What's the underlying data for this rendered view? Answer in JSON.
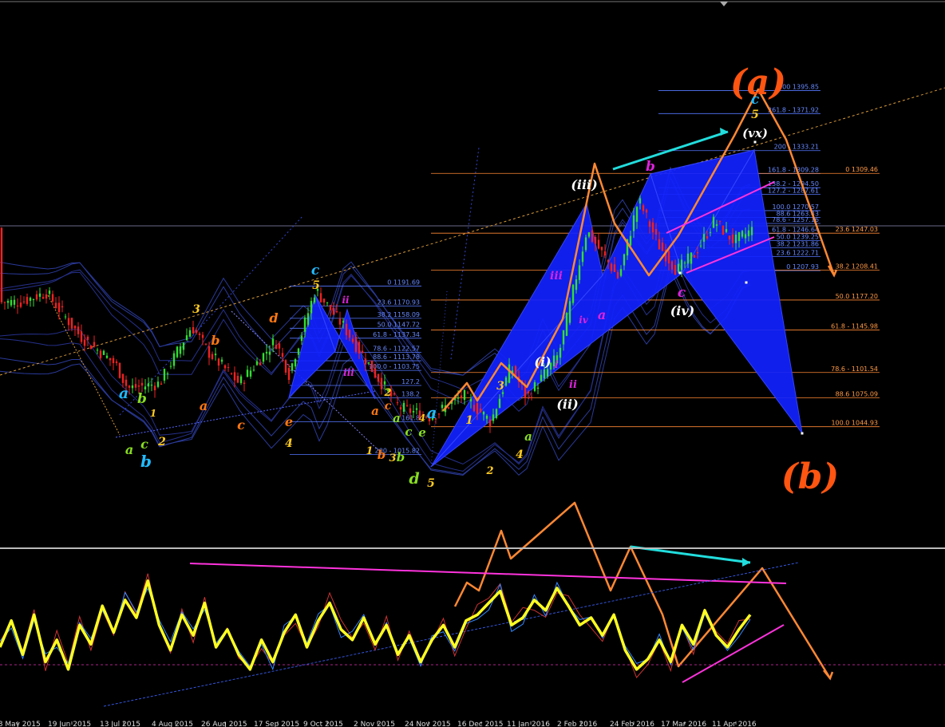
{
  "colors": {
    "background": "#000000",
    "candle_up": "#33dd33",
    "candle_down": "#ee2222",
    "fib_blue": "#5577ff",
    "fib_orange": "#ff8833",
    "pattern_fill": "#1122ff",
    "impulse_orange": "#ff8833",
    "cyan": "#22dddd",
    "magenta": "#ff33dd",
    "oscillator_main": "#ffff22",
    "oscillator_signal": "#3388ff"
  },
  "chart_data": [
    {
      "type": "candlestick",
      "panel": "price",
      "title": "",
      "xlabel": "",
      "ylabel": "",
      "ylim": [
        1000,
        1410
      ],
      "x_ticks": [
        "28 May 2015",
        "19 Jun 2015",
        "13 Jul 2015",
        "4 Aug 2015",
        "26 Aug 2015",
        "17 Sep 2015",
        "9 Oct 2015",
        "2 Nov 2015",
        "24 Nov 2015",
        "16 Dec 2015",
        "11 Jan 2016",
        "2 Feb 2016",
        "24 Feb 2016",
        "17 Mar 2016",
        "11 Apr 2016"
      ],
      "fib_levels_blue": [
        {
          "label": "0 1191.69",
          "price": 1191.69
        },
        {
          "label": "23.6 1170.93",
          "price": 1170.93
        },
        {
          "label": "38.2 1158.09",
          "price": 1158.09
        },
        {
          "label": "50.0 1147.72",
          "price": 1147.72
        },
        {
          "label": "61.8 - 1137.34",
          "price": 1137.34
        },
        {
          "label": "78.6 - 1122.57",
          "price": 1122.57
        },
        {
          "label": "88.6 - 1113.78",
          "price": 1113.78
        },
        {
          "label": "100.0 - 1103.75",
          "price": 1103.75
        },
        {
          "label": "127.2",
          "price": 1088
        },
        {
          "label": "138.2",
          "price": 1075
        },
        {
          "label": "161.8",
          "price": 1050
        },
        {
          "label": "200 - 1015.82",
          "price": 1015.82
        },
        {
          "label": "300 1395.85",
          "price": 1395.85
        },
        {
          "label": "261.8 - 1371.92",
          "price": 1371.92
        },
        {
          "label": "200 - 1333.21",
          "price": 1333.21
        },
        {
          "label": "161.8 - 1309.28",
          "price": 1309.28
        },
        {
          "label": "138.2 - 1294.50",
          "price": 1294.5
        },
        {
          "label": "127.2 - 1287.61",
          "price": 1287.61
        },
        {
          "label": "100.0 1270.57",
          "price": 1270.57
        },
        {
          "label": "88.6 1263.43",
          "price": 1263.43
        },
        {
          "label": "78.6 - 1257.16",
          "price": 1257.16
        },
        {
          "label": "61.8 - 1246.64",
          "price": 1246.64
        },
        {
          "label": "50.0 1239.25",
          "price": 1239.25
        },
        {
          "label": "38.2 1231.86",
          "price": 1231.86
        },
        {
          "label": "23.6 1222.71",
          "price": 1222.71
        },
        {
          "label": "0 1207.93",
          "price": 1207.93
        }
      ],
      "fib_levels_orange": [
        {
          "label": "0 1309.46",
          "price": 1309.46
        },
        {
          "label": "23.6 1247.03",
          "price": 1247.03
        },
        {
          "label": "38.2 1208.41",
          "price": 1208.41
        },
        {
          "label": "50.0 1177.20",
          "price": 1177.2
        },
        {
          "label": "61.8 - 1145.98",
          "price": 1145.98
        },
        {
          "label": "78.6 - 1101.54",
          "price": 1101.54
        },
        {
          "label": "88.6 1075.09",
          "price": 1075.09
        },
        {
          "label": "100.0 1044.93",
          "price": 1044.93
        }
      ],
      "wave_labels": [
        {
          "text": "(a)",
          "color": "#ff5511"
        },
        {
          "text": "(b)",
          "color": "#ff5511"
        },
        {
          "text": "c",
          "color": "#22bbff"
        },
        {
          "text": "5",
          "color": "#ffcc22"
        },
        {
          "text": "3",
          "color": "#ffcc22"
        },
        {
          "text": "d",
          "color": "#ff7711"
        },
        {
          "text": "b",
          "color": "#ff7711"
        },
        {
          "text": "a",
          "color": "#ff7711"
        },
        {
          "text": "c",
          "color": "#ff7711"
        },
        {
          "text": "e",
          "color": "#ff7711"
        },
        {
          "text": "4",
          "color": "#ffcc22"
        },
        {
          "text": "a",
          "color": "#22bbff"
        },
        {
          "text": "b",
          "color": "#88dd22"
        },
        {
          "text": "1",
          "color": "#ffcc22"
        },
        {
          "text": "a",
          "color": "#88dd22"
        },
        {
          "text": "c",
          "color": "#88dd22"
        },
        {
          "text": "2",
          "color": "#ffcc22"
        },
        {
          "text": "b",
          "color": "#22bbff"
        },
        {
          "text": "ii",
          "color": "#dd22dd"
        },
        {
          "text": "iii",
          "color": "#dd22dd"
        },
        {
          "text": "2",
          "color": "#ffcc22"
        },
        {
          "text": "a",
          "color": "#ff7711"
        },
        {
          "text": "c",
          "color": "#ff7711"
        },
        {
          "text": "1",
          "color": "#ffcc22"
        },
        {
          "text": "b",
          "color": "#ff7711"
        },
        {
          "text": "3",
          "color": "#ffcc22"
        },
        {
          "text": "b",
          "color": "#88dd22"
        },
        {
          "text": "a",
          "color": "#88dd22"
        },
        {
          "text": "c",
          "color": "#88dd22"
        },
        {
          "text": "e",
          "color": "#88dd22"
        },
        {
          "text": "d",
          "color": "#88dd22"
        },
        {
          "text": "5",
          "color": "#ffcc22"
        },
        {
          "text": "a",
          "color": "#22bbff"
        },
        {
          "text": "4",
          "color": "#ffcc22"
        },
        {
          "text": "1",
          "color": "#ffcc22"
        },
        {
          "text": "3",
          "color": "#ffcc22"
        },
        {
          "text": "2",
          "color": "#ffcc22"
        },
        {
          "text": "a",
          "color": "#88dd22"
        },
        {
          "text": "4",
          "color": "#ffcc22"
        },
        {
          "text": "(i)",
          "color": "#ffffff"
        },
        {
          "text": "i",
          "color": "#dd22dd"
        },
        {
          "text": "ii",
          "color": "#dd22dd"
        },
        {
          "text": "(ii)",
          "color": "#ffffff"
        },
        {
          "text": "iii",
          "color": "#dd22dd"
        },
        {
          "text": "iv",
          "color": "#dd22dd"
        },
        {
          "text": "a",
          "color": "#dd22dd"
        },
        {
          "text": "(iii)",
          "color": "#ffffff"
        },
        {
          "text": "b",
          "color": "#dd22dd"
        },
        {
          "text": "c",
          "color": "#dd22dd"
        },
        {
          "text": "(iv)",
          "color": "#ffffff"
        },
        {
          "text": "(vx)",
          "color": "#ffffff"
        },
        {
          "text": "5",
          "color": "#ffcc22"
        },
        {
          "text": "c",
          "color": "#22bbff"
        }
      ]
    },
    {
      "type": "line",
      "panel": "oscillator",
      "title": "",
      "xlabel": "",
      "ylabel": "",
      "ylim": [
        0,
        100
      ],
      "series": [
        {
          "values": [
            40,
            58,
            35,
            62,
            30,
            45,
            25,
            55,
            42,
            68,
            50,
            72,
            60,
            85,
            55,
            38,
            62,
            48,
            70,
            40,
            52,
            35,
            25,
            45,
            30,
            50,
            62,
            40,
            58,
            70,
            52,
            45,
            60,
            42,
            55,
            35,
            48,
            30,
            45,
            55,
            40,
            58,
            62,
            70,
            78,
            55,
            60,
            72,
            65,
            80,
            68,
            55,
            60,
            48,
            62,
            38,
            25,
            32,
            45,
            30,
            55,
            42,
            65,
            48,
            40,
            52,
            62
          ]
        }
      ]
    }
  ]
}
